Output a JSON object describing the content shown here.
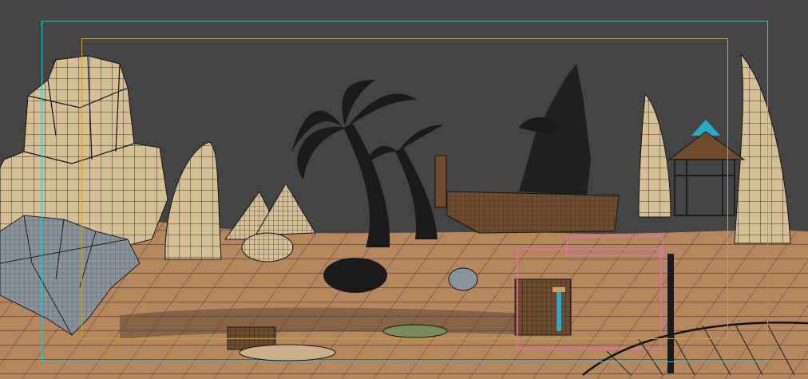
{
  "viewport": {
    "name": "3d-perspective-viewport",
    "mode": "wireframe-shaded",
    "colors": {
      "background": "#444444",
      "action_safe_frame": "#2fc2c8",
      "title_safe_frame": "#c9a23a",
      "sand": "#b5875e",
      "wire": "#141414",
      "rock": "#d6bf95",
      "stone_grey": "#8a929c",
      "palm": "#1a1a1a",
      "wood": "#6e4b2c",
      "gizmo_blue": "#2aa8c8",
      "selection_pink": "#e070b0"
    }
  }
}
